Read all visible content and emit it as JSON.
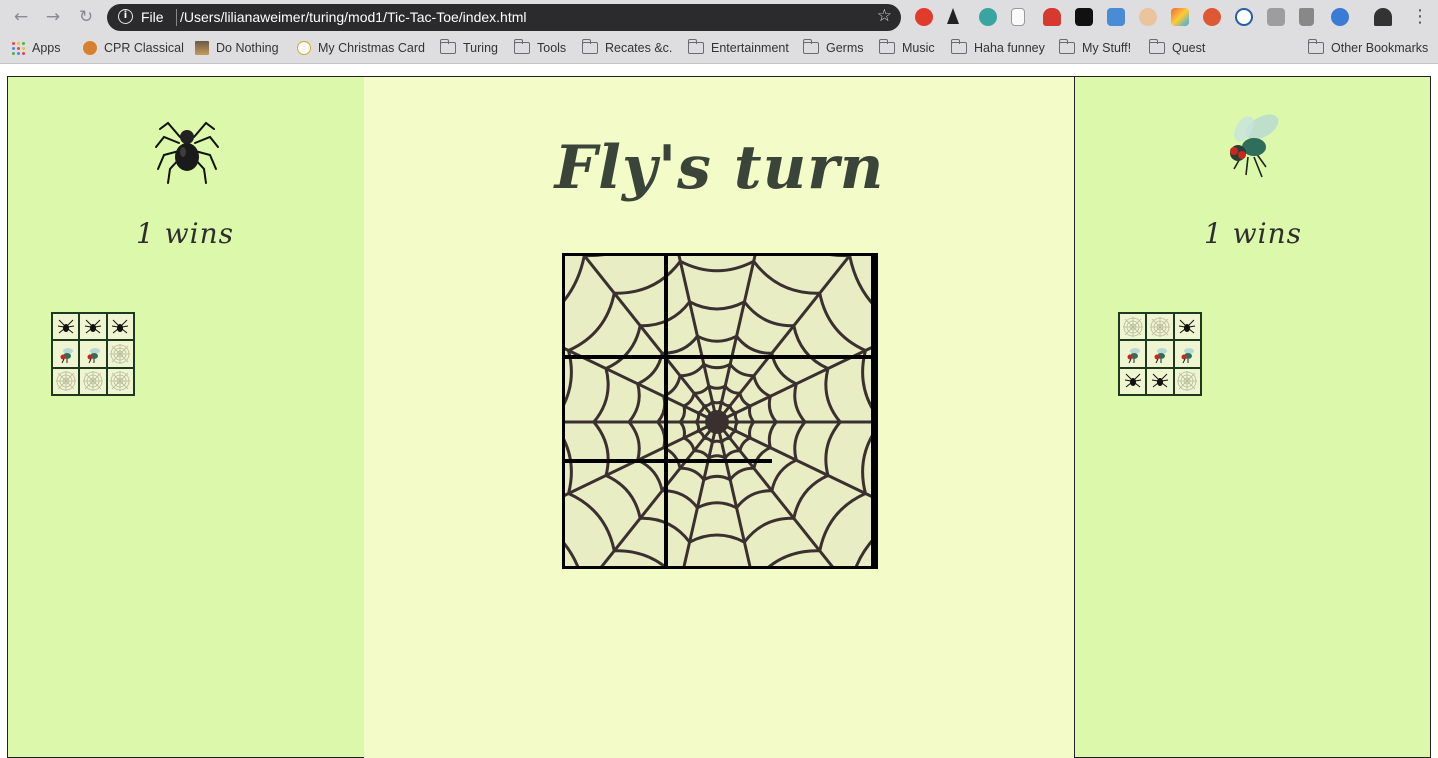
{
  "browser": {
    "scheme": "File",
    "url": "/Users/lilianaweimer/turing/mod1/Tic-Tac-Toe/index.html"
  },
  "bookmarks": [
    {
      "label": "Apps",
      "icon": "apps-grid-icon"
    },
    {
      "label": "CPR Classical",
      "icon": "cpr-favicon"
    },
    {
      "label": "Do Nothing",
      "icon": "do-nothing-favicon"
    },
    {
      "label": "My Christmas Card",
      "icon": "christmas-favicon"
    },
    {
      "label": "Turing",
      "icon": "folder-icon"
    },
    {
      "label": "Tools",
      "icon": "folder-icon"
    },
    {
      "label": "Recates &c.",
      "icon": "folder-icon"
    },
    {
      "label": "Entertainment",
      "icon": "folder-icon"
    },
    {
      "label": "Germs",
      "icon": "folder-icon"
    },
    {
      "label": "Music",
      "icon": "folder-icon"
    },
    {
      "label": "Haha funney",
      "icon": "folder-icon"
    },
    {
      "label": "My Stuff!",
      "icon": "folder-icon"
    },
    {
      "label": "Quest",
      "icon": "folder-icon"
    },
    {
      "label": "Other Bookmarks",
      "icon": "folder-icon"
    }
  ],
  "game": {
    "turn_title": "Fly's turn",
    "spider": {
      "wins_label": "1 wins",
      "avatar": "spider-icon"
    },
    "fly": {
      "wins_label": "1 wins",
      "avatar": "fly-icon"
    },
    "spider_won_boards": [
      [
        "spider",
        "spider",
        "spider",
        "fly",
        "fly",
        "web",
        "web",
        "web",
        "web"
      ]
    ],
    "fly_won_boards": [
      [
        "web",
        "web",
        "spider",
        "fly",
        "fly",
        "fly",
        "spider",
        "spider",
        "web"
      ]
    ],
    "board": [
      "",
      "",
      "",
      "",
      "",
      "",
      "",
      "",
      ""
    ]
  },
  "colors": {
    "side_panel": "#dcf8aa",
    "center_panel": "#f3fcc8",
    "board_bg": "#e9edc4",
    "web_stroke": "#3b3030"
  }
}
